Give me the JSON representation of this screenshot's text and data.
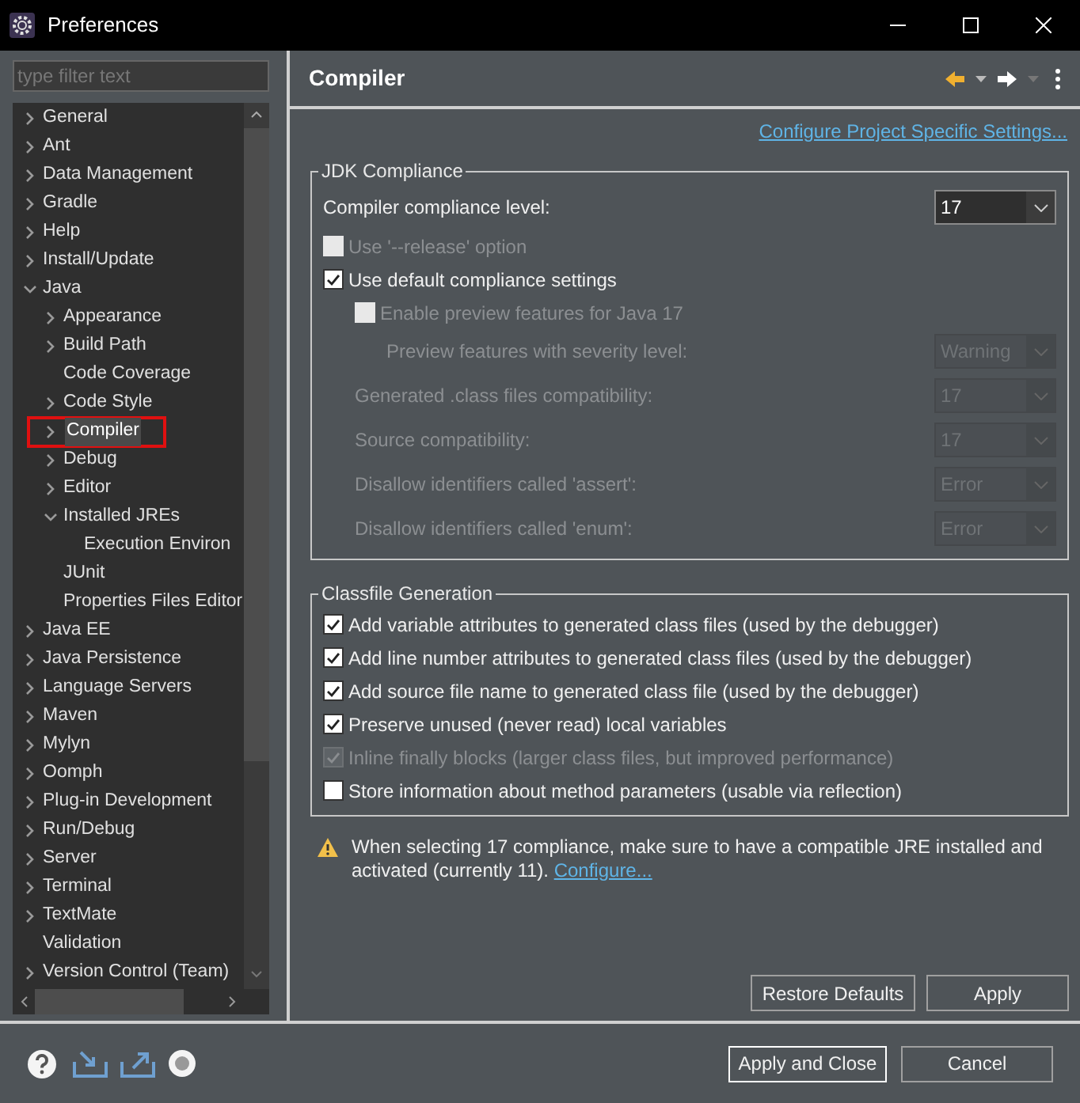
{
  "window": {
    "title": "Preferences"
  },
  "filter": {
    "placeholder": "type filter text"
  },
  "tree": [
    {
      "label": "General",
      "kind": "folder",
      "expanded": false,
      "selected": false,
      "annotated": false
    },
    {
      "label": "Ant",
      "kind": "folder",
      "expanded": false,
      "selected": false,
      "annotated": false
    },
    {
      "label": "Data Management",
      "kind": "folder",
      "expanded": false,
      "selected": false,
      "annotated": false
    },
    {
      "label": "Gradle",
      "kind": "folder",
      "expanded": false,
      "selected": false,
      "annotated": false
    },
    {
      "label": "Help",
      "kind": "folder",
      "expanded": false,
      "selected": false,
      "annotated": false
    },
    {
      "label": "Install/Update",
      "kind": "folder",
      "expanded": false,
      "selected": false,
      "annotated": false
    },
    {
      "label": "Java",
      "kind": "folder",
      "expanded": true,
      "selected": false,
      "annotated": false,
      "children": [
        {
          "label": "Appearance",
          "kind": "folder",
          "expanded": false,
          "selected": false,
          "annotated": false
        },
        {
          "label": "Build Path",
          "kind": "folder",
          "expanded": false,
          "selected": false,
          "annotated": false
        },
        {
          "label": "Code Coverage",
          "kind": "leaf",
          "selected": false,
          "annotated": false
        },
        {
          "label": "Code Style",
          "kind": "folder",
          "expanded": false,
          "selected": false,
          "annotated": false
        },
        {
          "label": "Compiler",
          "kind": "folder",
          "expanded": false,
          "selected": true,
          "annotated": true
        },
        {
          "label": "Debug",
          "kind": "folder",
          "expanded": false,
          "selected": false,
          "annotated": false
        },
        {
          "label": "Editor",
          "kind": "folder",
          "expanded": false,
          "selected": false,
          "annotated": false
        },
        {
          "label": "Installed JREs",
          "kind": "folder",
          "expanded": true,
          "selected": false,
          "annotated": false,
          "children": [
            {
              "label": "Execution Environ",
              "kind": "leaf",
              "selected": false,
              "annotated": false
            }
          ]
        },
        {
          "label": "JUnit",
          "kind": "leaf",
          "selected": false,
          "annotated": false
        },
        {
          "label": "Properties Files Editor",
          "kind": "leaf",
          "selected": false,
          "annotated": false
        }
      ]
    },
    {
      "label": "Java EE",
      "kind": "folder",
      "expanded": false,
      "selected": false,
      "annotated": false
    },
    {
      "label": "Java Persistence",
      "kind": "folder",
      "expanded": false,
      "selected": false,
      "annotated": false
    },
    {
      "label": "Language Servers",
      "kind": "folder",
      "expanded": false,
      "selected": false,
      "annotated": false
    },
    {
      "label": "Maven",
      "kind": "folder",
      "expanded": false,
      "selected": false,
      "annotated": false
    },
    {
      "label": "Mylyn",
      "kind": "folder",
      "expanded": false,
      "selected": false,
      "annotated": false
    },
    {
      "label": "Oomph",
      "kind": "folder",
      "expanded": false,
      "selected": false,
      "annotated": false
    },
    {
      "label": "Plug-in Development",
      "kind": "folder",
      "expanded": false,
      "selected": false,
      "annotated": false
    },
    {
      "label": "Run/Debug",
      "kind": "folder",
      "expanded": false,
      "selected": false,
      "annotated": false
    },
    {
      "label": "Server",
      "kind": "folder",
      "expanded": false,
      "selected": false,
      "annotated": false
    },
    {
      "label": "Terminal",
      "kind": "folder",
      "expanded": false,
      "selected": false,
      "annotated": false
    },
    {
      "label": "TextMate",
      "kind": "folder",
      "expanded": false,
      "selected": false,
      "annotated": false
    },
    {
      "label": "Validation",
      "kind": "leaf",
      "selected": false,
      "annotated": false
    },
    {
      "label": "Version Control (Team)",
      "kind": "folder",
      "expanded": false,
      "selected": false,
      "annotated": false
    }
  ],
  "page": {
    "title": "Compiler",
    "link": "Configure Project Specific Settings...",
    "groups": [
      {
        "title": "JDK Compliance",
        "rows": [
          {
            "kind": "combo",
            "label": "Compiler compliance level:",
            "value": "17",
            "disabled": false
          },
          {
            "kind": "checkbox",
            "label": "Use '--release' option",
            "checked": false,
            "disabled": true
          },
          {
            "kind": "checkbox",
            "label": "Use default compliance settings",
            "checked": true,
            "disabled": false,
            "children": [
              {
                "kind": "checkbox",
                "label": "Enable preview features for Java 17",
                "checked": false,
                "disabled": true,
                "children": [
                  {
                    "kind": "combo",
                    "label": "Preview features with severity level:",
                    "value": "Warning",
                    "disabled": true
                  }
                ]
              },
              {
                "kind": "combo",
                "label": "Generated .class files compatibility:",
                "value": "17",
                "disabled": true
              },
              {
                "kind": "combo",
                "label": "Source compatibility:",
                "value": "17",
                "disabled": true
              },
              {
                "kind": "combo",
                "label": "Disallow identifiers called 'assert':",
                "value": "Error",
                "disabled": true
              },
              {
                "kind": "combo",
                "label": "Disallow identifiers called 'enum':",
                "value": "Error",
                "disabled": true
              }
            ]
          }
        ]
      },
      {
        "title": "Classfile Generation",
        "rows": [
          {
            "kind": "checkbox",
            "label": "Add variable attributes to generated class files (used by the debugger)",
            "checked": true,
            "disabled": false
          },
          {
            "kind": "checkbox",
            "label": "Add line number attributes to generated class files (used by the debugger)",
            "checked": true,
            "disabled": false
          },
          {
            "kind": "checkbox",
            "label": "Add source file name to generated class file (used by the debugger)",
            "checked": true,
            "disabled": false
          },
          {
            "kind": "checkbox",
            "label": "Preserve unused (never read) local variables",
            "checked": true,
            "disabled": false
          },
          {
            "kind": "checkbox",
            "label": "Inline finally blocks (larger class files, but improved performance)",
            "checked": true,
            "disabled": true
          },
          {
            "kind": "checkbox",
            "label": "Store information about method parameters (usable via reflection)",
            "checked": false,
            "disabled": false
          }
        ]
      }
    ],
    "warning": {
      "text": "When selecting 17 compliance, make sure to have a compatible JRE installed and activated (currently 11).",
      "link": "Configure..."
    },
    "buttons": [
      {
        "label": "Restore Defaults",
        "default": false
      },
      {
        "label": "Apply",
        "default": false
      }
    ]
  },
  "dialog_buttons": [
    {
      "label": "Apply and Close",
      "default": true
    },
    {
      "label": "Cancel",
      "default": false
    }
  ]
}
